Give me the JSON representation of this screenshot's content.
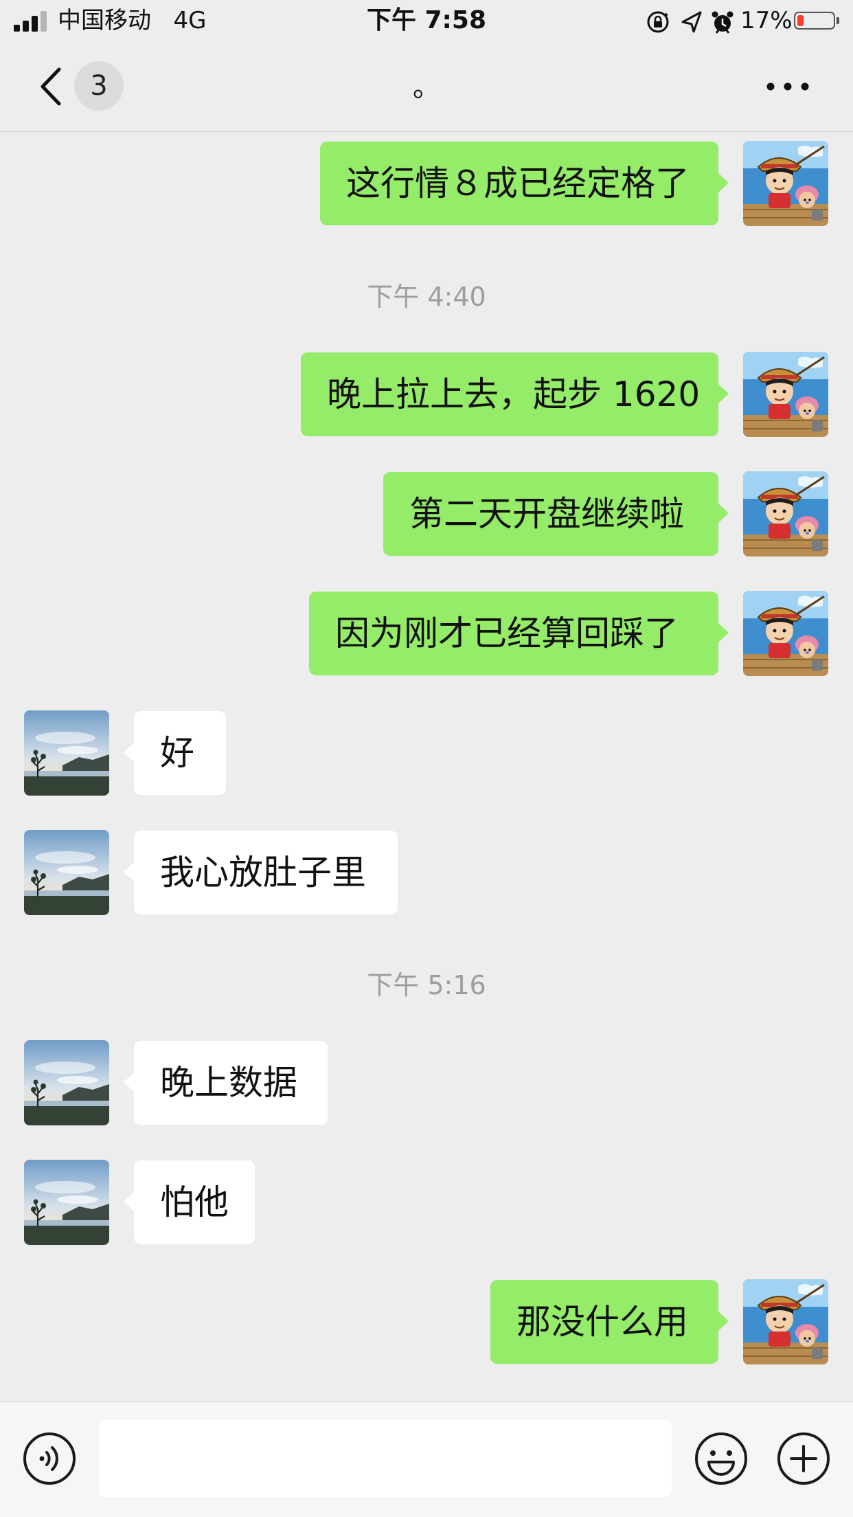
{
  "status_bar": {
    "carrier": "中国移动",
    "network": "4G",
    "time": "下午 7:58",
    "battery": "17%",
    "battery_level": 0.17,
    "icons": [
      "orientation-lock-icon",
      "location-arrow-icon",
      "alarm-icon"
    ]
  },
  "nav": {
    "back_icon": "chevron-left-icon",
    "unread_count": "3",
    "title": "。",
    "more_icon": "more-dots-icon"
  },
  "messages": [
    {
      "id": "m1",
      "kind": "bubble",
      "sender": "me",
      "text": "这行情８成已经定格了"
    },
    {
      "id": "t1",
      "kind": "time",
      "text": "下午 4:40"
    },
    {
      "id": "m2",
      "kind": "bubble",
      "sender": "me",
      "text": "晚上拉上去，起步 1620"
    },
    {
      "id": "m3",
      "kind": "bubble",
      "sender": "me",
      "text": "第二天开盘继续啦"
    },
    {
      "id": "m4",
      "kind": "bubble",
      "sender": "me",
      "text": "因为刚才已经算回踩了"
    },
    {
      "id": "m5",
      "kind": "bubble",
      "sender": "them",
      "text": "好"
    },
    {
      "id": "m6",
      "kind": "bubble",
      "sender": "them",
      "text": "我心放肚子里"
    },
    {
      "id": "t2",
      "kind": "time",
      "text": "下午 5:16"
    },
    {
      "id": "m7",
      "kind": "bubble",
      "sender": "them",
      "text": "晚上数据"
    },
    {
      "id": "m8",
      "kind": "bubble",
      "sender": "them",
      "text": "怕他"
    },
    {
      "id": "m9",
      "kind": "bubble",
      "sender": "me",
      "text": "那没什么用"
    }
  ],
  "input_bar": {
    "voice_icon": "voice-icon",
    "message_value": "",
    "emoji_icon": "emoji-icon",
    "plus_icon": "plus-icon"
  },
  "colors": {
    "background": "#ededed",
    "my_bubble": "#95ec69",
    "their_bubble": "#ffffff",
    "timestamp_text": "#9d9d9d",
    "battery_low": "#ff3b30"
  }
}
